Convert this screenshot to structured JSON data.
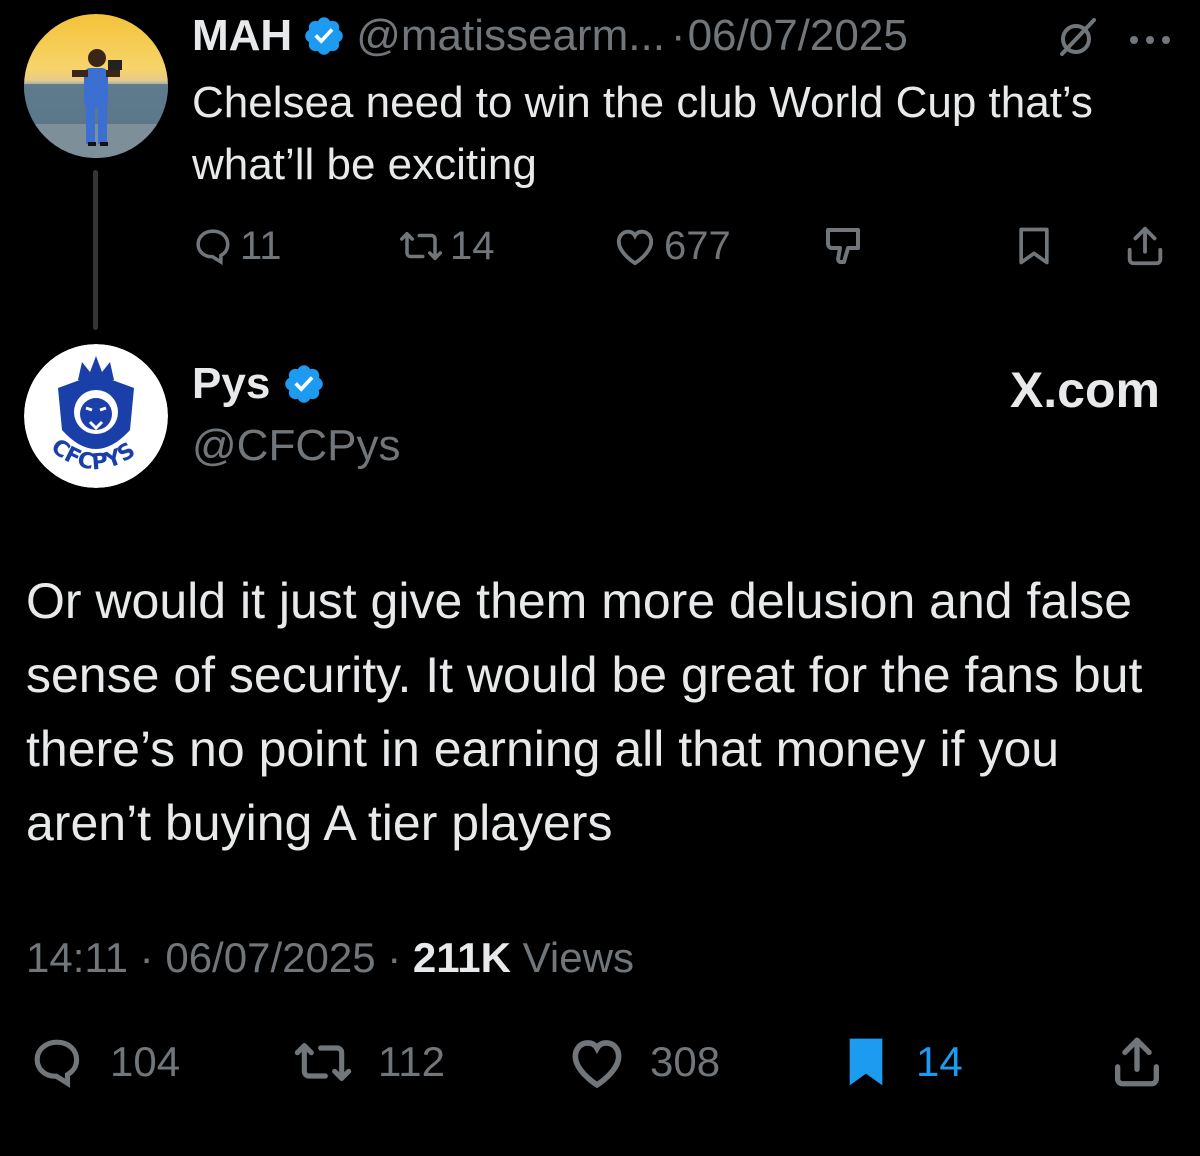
{
  "parent_tweet": {
    "name": "MAH",
    "handle": "@matissearm...",
    "separator": "·",
    "date": "06/07/2025",
    "text": "Chelsea need to win the club World Cup that’s what’ll be exciting",
    "replies": "11",
    "reposts": "14",
    "likes": "677"
  },
  "main_tweet": {
    "name": "Pys",
    "handle": "@CFCPys",
    "source_badge": "X.com",
    "text": "Or would it just give them more delusion and false sense of security. It would be great for the fans but there’s no point in earning all that money if you aren’t buying A tier players",
    "time": "14:11",
    "separator": "·",
    "date": "06/07/2025",
    "views_count": "211K",
    "views_label": "Views",
    "replies": "104",
    "reposts": "112",
    "likes": "308",
    "bookmarks": "14",
    "avatar_text": "CFCPYS"
  },
  "colors": {
    "background": "#000000",
    "text": "#e7e9ea",
    "muted": "#71767b",
    "accent": "#1d9bf0",
    "thread_line": "#333639"
  },
  "icons": {
    "verified": "verified-badge-icon",
    "grok": "grok-icon",
    "more": "more-icon",
    "reply": "reply-icon",
    "repost": "repost-icon",
    "like": "heart-icon",
    "dislike": "dislike-icon",
    "bookmark": "bookmark-icon",
    "share": "share-icon"
  }
}
